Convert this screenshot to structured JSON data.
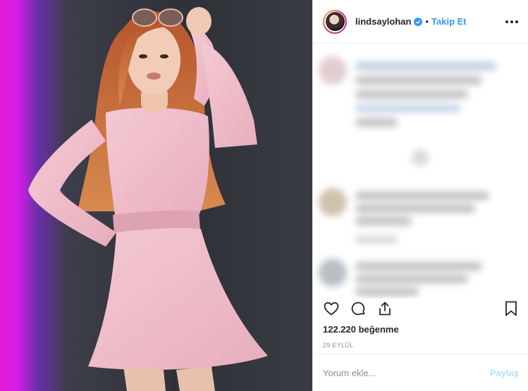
{
  "post": {
    "username": "lindsaylohan",
    "separator": "•",
    "follow_label": "Takip Et",
    "likes_text": "122.220 beğenme",
    "date_text": "29 EYLÜL"
  },
  "comment_box": {
    "placeholder": "Yorum ekle...",
    "share_label": "Paylaş"
  },
  "icons": {
    "verified": "verified-badge-icon",
    "more": "more-options-icon",
    "like": "heart-icon",
    "comment": "comment-icon",
    "share": "share-icon",
    "save": "bookmark-icon"
  },
  "colors": {
    "link_blue": "#3897f0",
    "share_disabled": "#b2dffc",
    "muted_text": "#8e8e8e"
  }
}
